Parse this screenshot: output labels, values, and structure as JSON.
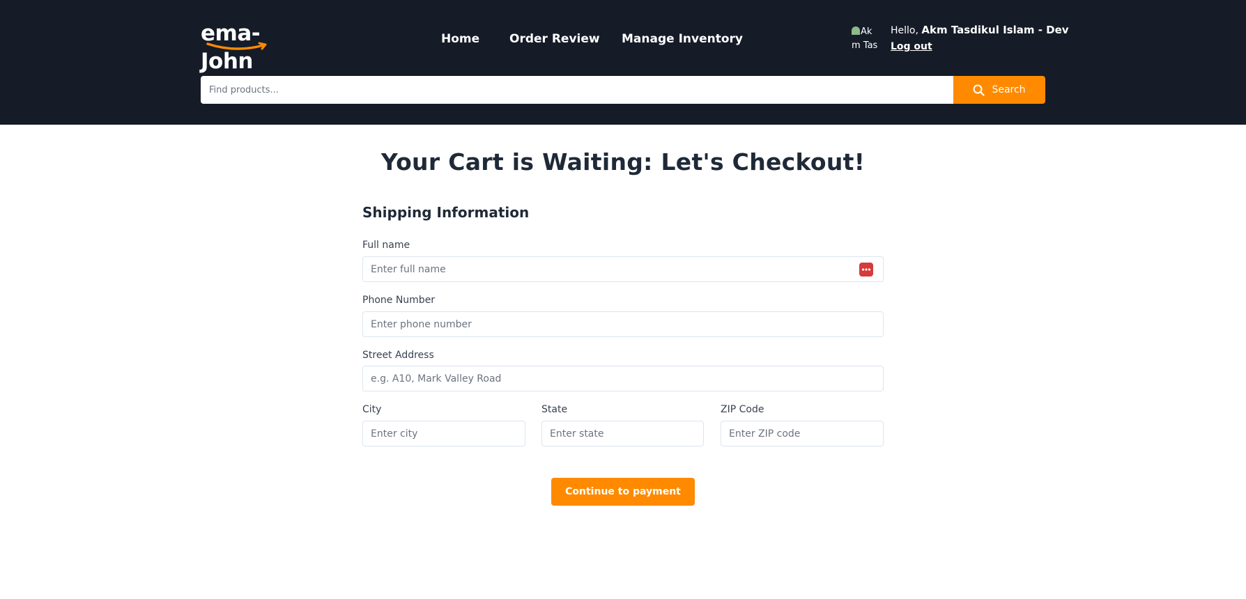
{
  "brand": {
    "logo_text": "ema-John",
    "logo_color": "#ffffff",
    "smile_color": "#ff8a00"
  },
  "nav": {
    "items": [
      {
        "label": "Home"
      },
      {
        "label": "Order Review"
      },
      {
        "label": "Manage Inventory"
      }
    ]
  },
  "user": {
    "avatar_alt": "Akm Tasdikul Islam",
    "hello": "Hello, ",
    "name": "Akm Tasdikul Islam - Dev",
    "logout": "Log out"
  },
  "search": {
    "placeholder": "Find products...",
    "button_label": "Search",
    "icon": "search-icon"
  },
  "checkout": {
    "title": "Your Cart is Waiting: Let's Checkout!",
    "section_title": "Shipping Information",
    "fields": {
      "full_name": {
        "label": "Full name",
        "placeholder": "Enter full name",
        "value": ""
      },
      "phone": {
        "label": "Phone Number",
        "placeholder": "Enter phone number",
        "value": ""
      },
      "street": {
        "label": "Street Address",
        "placeholder": "e.g. A10, Mark Valley Road",
        "value": ""
      },
      "city": {
        "label": "City",
        "placeholder": "Enter city",
        "value": ""
      },
      "state": {
        "label": "State",
        "placeholder": "Enter state",
        "value": ""
      },
      "zip": {
        "label": "ZIP Code",
        "placeholder": "Enter ZIP code",
        "value": ""
      }
    },
    "continue_label": "Continue to payment"
  },
  "colors": {
    "header_bg": "#151b27",
    "accent": "#ff8a00",
    "input_border": "#dbe5f3",
    "password_manager_icon": "#d63a3a"
  }
}
